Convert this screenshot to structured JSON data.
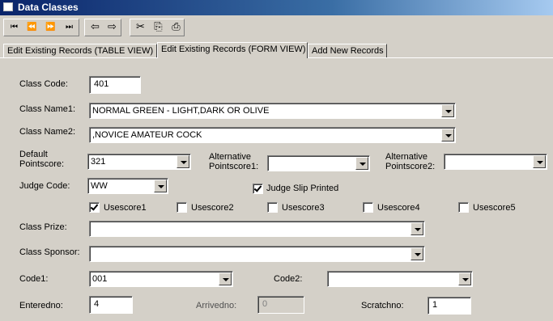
{
  "window": {
    "title": "Data Classes"
  },
  "toolbar": {
    "nav_first": "⏮",
    "nav_prev": "⏪",
    "nav_next": "⏩",
    "nav_last": "⏭",
    "back": "⇦",
    "forward": "⇨",
    "cut": "✂",
    "copy": "⎘",
    "paste": "⎙"
  },
  "tabs": [
    {
      "label": "Edit Existing Records (TABLE VIEW)"
    },
    {
      "label": "Edit Existing Records (FORM VIEW)"
    },
    {
      "label": "Add New Records"
    }
  ],
  "form": {
    "class_code": {
      "label": "Class Code:",
      "value": "401"
    },
    "class_name1": {
      "label": "Class Name1:",
      "value": "NORMAL GREEN - LIGHT,DARK OR OLIVE"
    },
    "class_name2": {
      "label": "Class Name2:",
      "value": ",NOVICE AMATEUR COCK"
    },
    "default_pointscore": {
      "label_line1": "Default",
      "label_line2": "Pointscore:",
      "value": "321"
    },
    "alt_pointscore1": {
      "label_line1": "Alternative",
      "label_line2": "Pointscore1:",
      "value": ""
    },
    "alt_pointscore2": {
      "label_line1": "Alternative",
      "label_line2": "Pointscore2:",
      "value": ""
    },
    "judge_code": {
      "label": "Judge Code:",
      "value": "WW"
    },
    "judge_slip": {
      "label": "Judge Slip Printed",
      "checked": true
    },
    "usescores": [
      {
        "label": "Usescore1",
        "checked": true
      },
      {
        "label": "Usescore2",
        "checked": false
      },
      {
        "label": "Usescore3",
        "checked": false
      },
      {
        "label": "Usescore4",
        "checked": false
      },
      {
        "label": "Usescore5",
        "checked": false
      }
    ],
    "class_prize": {
      "label": "Class Prize:",
      "value": ""
    },
    "class_sponsor": {
      "label": "Class Sponsor:",
      "value": ""
    },
    "code1": {
      "label": "Code1:",
      "value": "001"
    },
    "code2": {
      "label": "Code2:",
      "value": ""
    },
    "enteredno": {
      "label": "Enteredno:",
      "value": "4"
    },
    "arrivedno": {
      "label": "Arrivedno:",
      "value": "0"
    },
    "scratchno": {
      "label": "Scratchno:",
      "value": "1"
    }
  }
}
